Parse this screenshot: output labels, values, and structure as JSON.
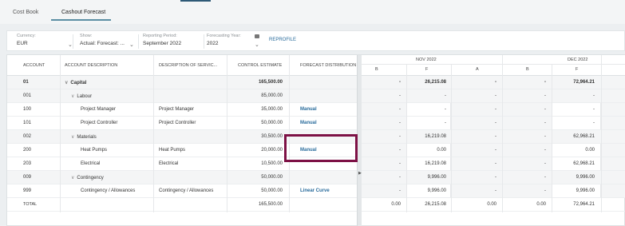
{
  "tabs": [
    {
      "label": "Cost Book",
      "active": false
    },
    {
      "label": "Cashout Forecast",
      "active": true
    }
  ],
  "filters": {
    "currency": {
      "label": "Currency:",
      "value": "EUR"
    },
    "show": {
      "label": "Show:",
      "value": "Actual: Forecast: ..."
    },
    "period": {
      "label": "Reporting Period:",
      "value": "September 2022"
    },
    "year": {
      "label": "Forecasting Year:",
      "value": "2022"
    },
    "reprofile": "REPROFILE"
  },
  "columns": {
    "account": "ACCOUNT",
    "account_description": "ACCOUNT DESCRIPTION",
    "service_description": "DESCRIPTION OF SERVIC...",
    "control_estimate": "CONTROL ESTIMATE",
    "forecast_distribution": "FORECAST DISTRIBUTION"
  },
  "months": [
    {
      "name": "NOV 2022",
      "subcols": [
        "B",
        "F",
        "A"
      ]
    },
    {
      "name": "DEC 2022",
      "subcols": [
        "B",
        "F"
      ]
    }
  ],
  "rows": [
    {
      "account": "01",
      "desc": "Capital",
      "service": "",
      "estimate": "165,500.00",
      "dist": "",
      "nov_b": "-",
      "nov_f": "26,215.08",
      "nov_a": "-",
      "dec_b": "-",
      "dec_f": "72,964.21",
      "level": 0
    },
    {
      "account": "001",
      "desc": "Labour",
      "service": "",
      "estimate": "85,000.00",
      "dist": "",
      "nov_b": "-",
      "nov_f": "-",
      "nov_a": "-",
      "dec_b": "-",
      "dec_f": "-",
      "level": 1
    },
    {
      "account": "100",
      "desc": "Project Manager",
      "service": "Project Manager",
      "estimate": "35,000.00",
      "dist": "Manual",
      "nov_b": "-",
      "nov_f": "-",
      "nov_a": "-",
      "dec_b": "-",
      "dec_f": "-",
      "level": 2
    },
    {
      "account": "101",
      "desc": "Project Controller",
      "service": "Project Controller",
      "estimate": "50,000.00",
      "dist": "Manual",
      "nov_b": "-",
      "nov_f": "-",
      "nov_a": "-",
      "dec_b": "-",
      "dec_f": "-",
      "level": 2
    },
    {
      "account": "002",
      "desc": "Materials",
      "service": "",
      "estimate": "30,500.00",
      "dist": "",
      "nov_b": "-",
      "nov_f": "16,219.08",
      "nov_a": "-",
      "dec_b": "-",
      "dec_f": "62,968.21",
      "level": 1
    },
    {
      "account": "200",
      "desc": "Heat Pumps",
      "service": "Heat Pumps",
      "estimate": "20,000.00",
      "dist": "Manual",
      "nov_b": "-",
      "nov_f": "0.00",
      "nov_a": "-",
      "dec_b": "-",
      "dec_f": "0.00",
      "level": 2
    },
    {
      "account": "203",
      "desc": "Electrical",
      "service": "Electrical",
      "estimate": "10,500.00",
      "dist": "",
      "nov_b": "-",
      "nov_f": "16,219.08",
      "nov_a": "-",
      "dec_b": "-",
      "dec_f": "62,968.21",
      "level": 2
    },
    {
      "account": "009",
      "desc": "Contingency",
      "service": "",
      "estimate": "50,000.00",
      "dist": "",
      "nov_b": "-",
      "nov_f": "9,996.00",
      "nov_a": "-",
      "dec_b": "-",
      "dec_f": "9,996.00",
      "level": 1
    },
    {
      "account": "999",
      "desc": "Contingency / Allowances",
      "service": "Contingency / Allowances",
      "estimate": "50,000.00",
      "dist": "Linear Curve",
      "nov_b": "-",
      "nov_f": "9,996.00",
      "nov_a": "-",
      "dec_b": "-",
      "dec_f": "9,996.00",
      "level": 2
    }
  ],
  "total": {
    "label": "TOTAL",
    "estimate": "165,500.00",
    "nov_b": "0.00",
    "nov_f": "26,215.08",
    "nov_a": "0.00",
    "dec_b": "0.00",
    "dec_f": "72,964.21"
  },
  "colors": {
    "accent": "#2a6c9c",
    "highlight": "#7d1145"
  }
}
